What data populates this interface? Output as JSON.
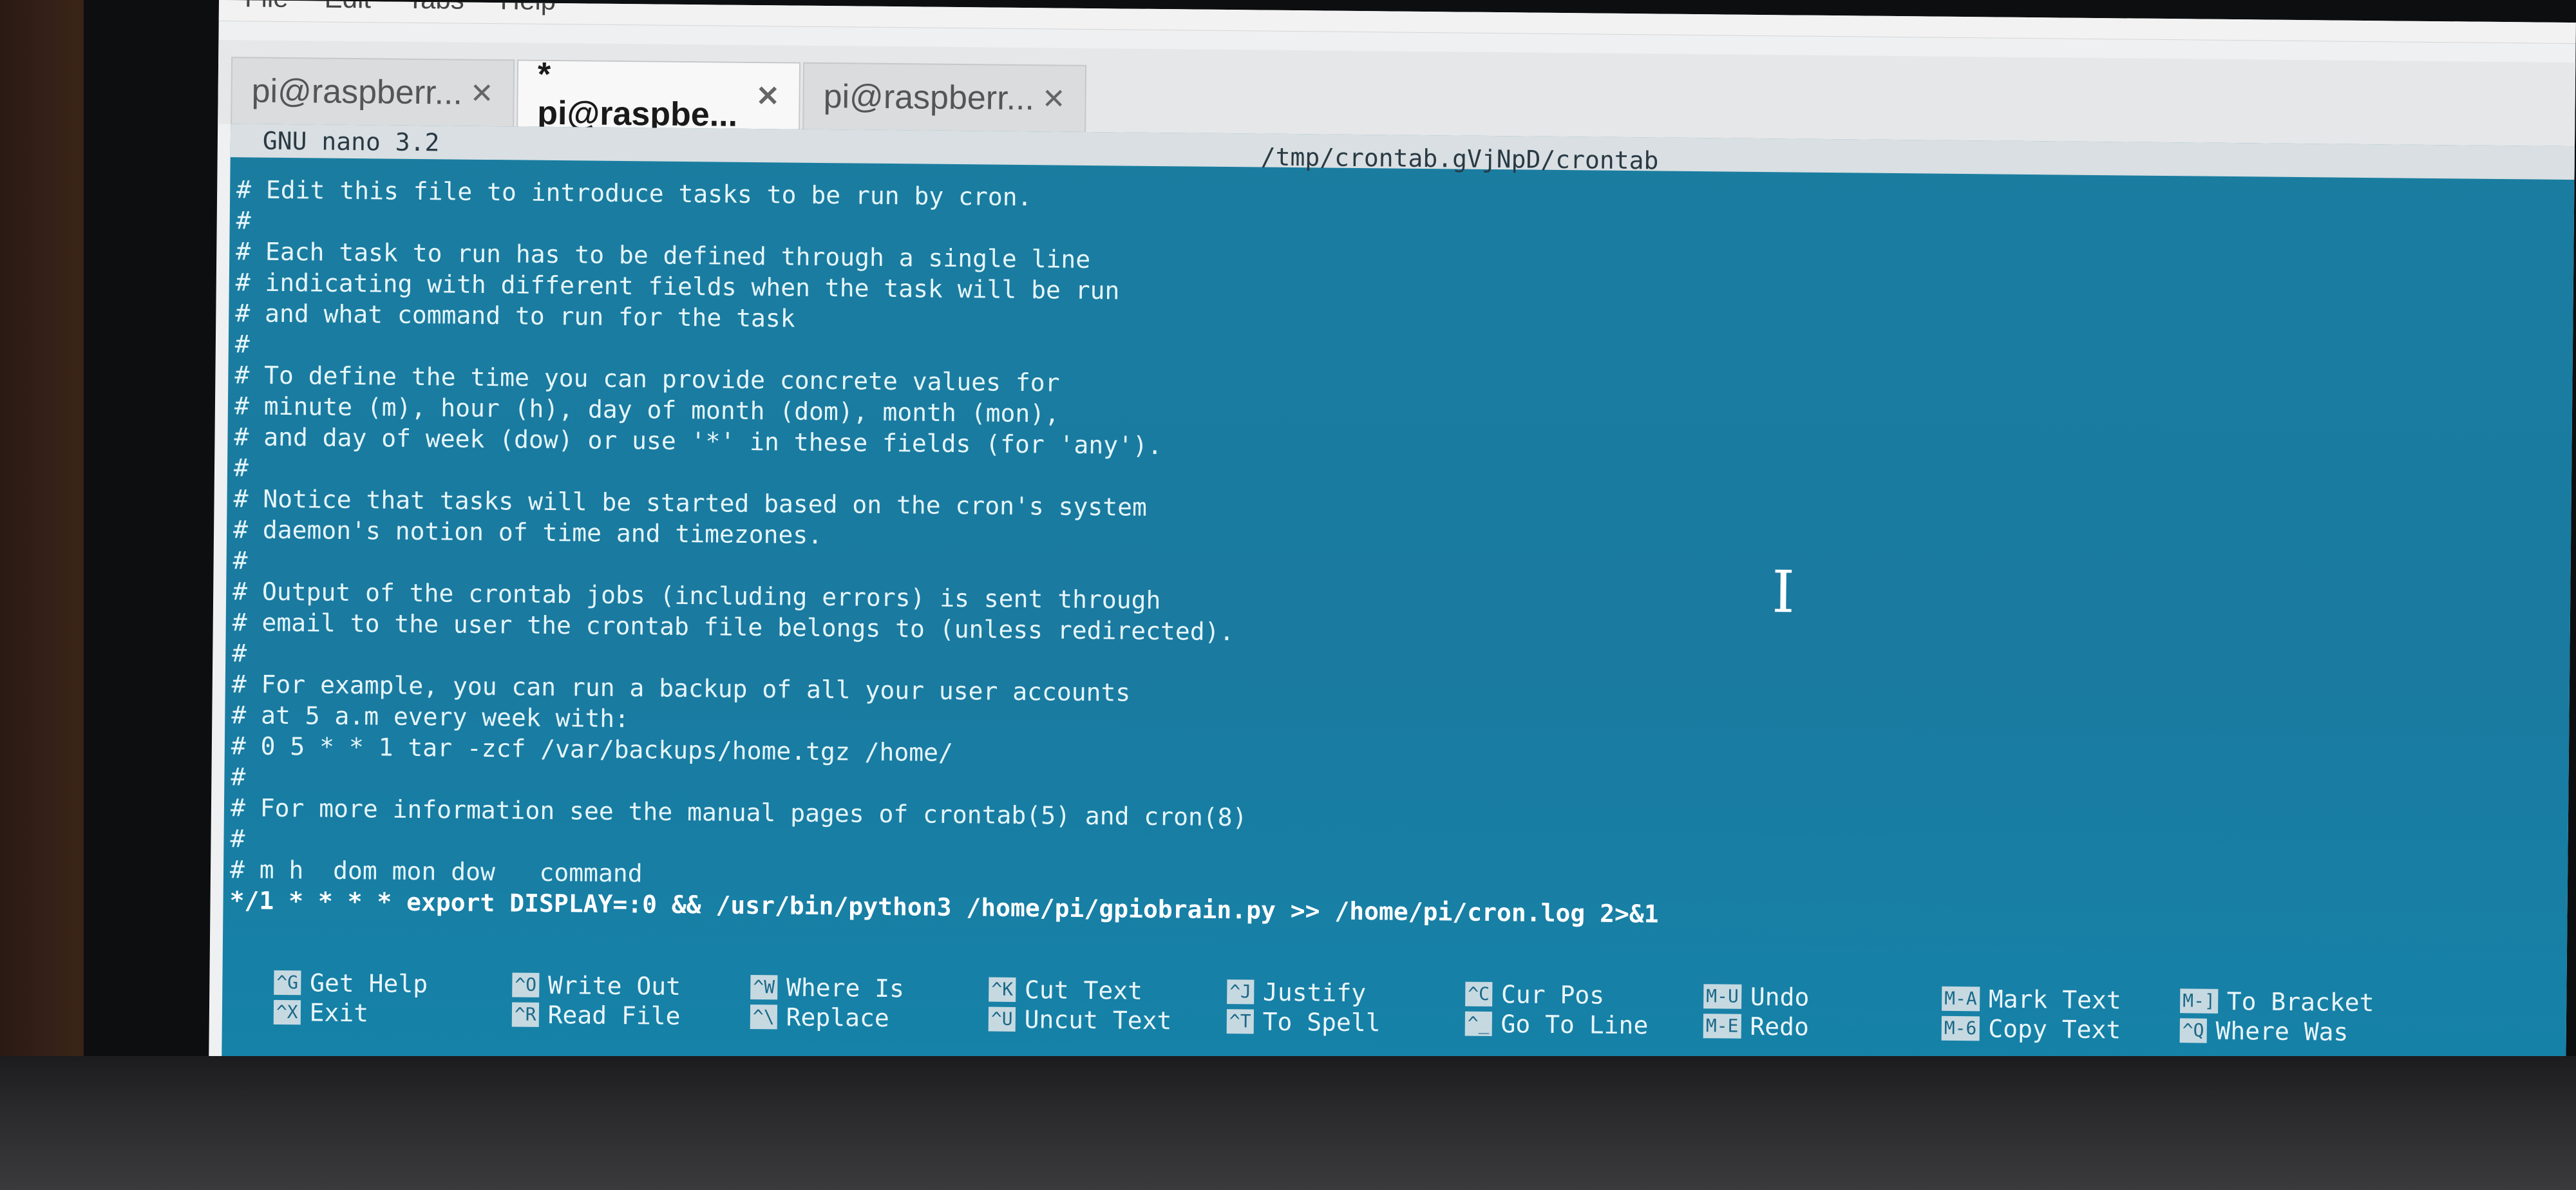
{
  "menu": {
    "items": [
      {
        "label": "File"
      },
      {
        "label": "Edit"
      },
      {
        "label": "Tabs"
      },
      {
        "label": "Help"
      }
    ]
  },
  "tabs": [
    {
      "label": "pi@raspberr...",
      "active": false
    },
    {
      "label": "* pi@raspbe...",
      "active": true
    },
    {
      "label": "pi@raspberr...",
      "active": false
    }
  ],
  "tab_close_glyph": "✕",
  "nano": {
    "version": "GNU nano 3.2",
    "file": "/tmp/crontab.gVjNpD/crontab"
  },
  "lines": [
    "# Edit this file to introduce tasks to be run by cron.",
    "#",
    "# Each task to run has to be defined through a single line",
    "# indicating with different fields when the task will be run",
    "# and what command to run for the task",
    "#",
    "# To define the time you can provide concrete values for",
    "# minute (m), hour (h), day of month (dom), month (mon),",
    "# and day of week (dow) or use '*' in these fields (for 'any').",
    "#",
    "# Notice that tasks will be started based on the cron's system",
    "# daemon's notion of time and timezones.",
    "#",
    "# Output of the crontab jobs (including errors) is sent through",
    "# email to the user the crontab file belongs to (unless redirected).",
    "#",
    "# For example, you can run a backup of all your user accounts",
    "# at 5 a.m every week with:",
    "# 0 5 * * 1 tar -zcf /var/backups/home.tgz /home/",
    "#",
    "# For more information see the manual pages of crontab(5) and cron(8)",
    "#",
    "# m h  dom mon dow   command",
    "*/1 * * * * export DISPLAY=:0 && /usr/bin/python3 /home/pi/gpiobrain.py >> /home/pi/cron.log 2>&1"
  ],
  "shortcuts": {
    "row1": [
      {
        "key": "^G",
        "label": "Get Help"
      },
      {
        "key": "^O",
        "label": "Write Out"
      },
      {
        "key": "^W",
        "label": "Where Is"
      },
      {
        "key": "^K",
        "label": "Cut Text"
      },
      {
        "key": "^J",
        "label": "Justify"
      },
      {
        "key": "^C",
        "label": "Cur Pos"
      },
      {
        "key": "M-U",
        "label": "Undo"
      },
      {
        "key": "M-A",
        "label": "Mark Text"
      },
      {
        "key": "M-]",
        "label": "To Bracket"
      }
    ],
    "row2": [
      {
        "key": "^X",
        "label": "Exit"
      },
      {
        "key": "^R",
        "label": "Read File"
      },
      {
        "key": "^\\",
        "label": "Replace"
      },
      {
        "key": "^U",
        "label": "Uncut Text"
      },
      {
        "key": "^T",
        "label": "To Spell"
      },
      {
        "key": "^_",
        "label": "Go To Line"
      },
      {
        "key": "M-E",
        "label": "Redo"
      },
      {
        "key": "M-6",
        "label": "Copy Text"
      },
      {
        "key": "^Q",
        "label": "Where Was"
      }
    ]
  },
  "colors": {
    "terminal_bg": "#1a7da0",
    "title_bar_bg": "#d9dfe2",
    "text": "#e6f6fb"
  }
}
